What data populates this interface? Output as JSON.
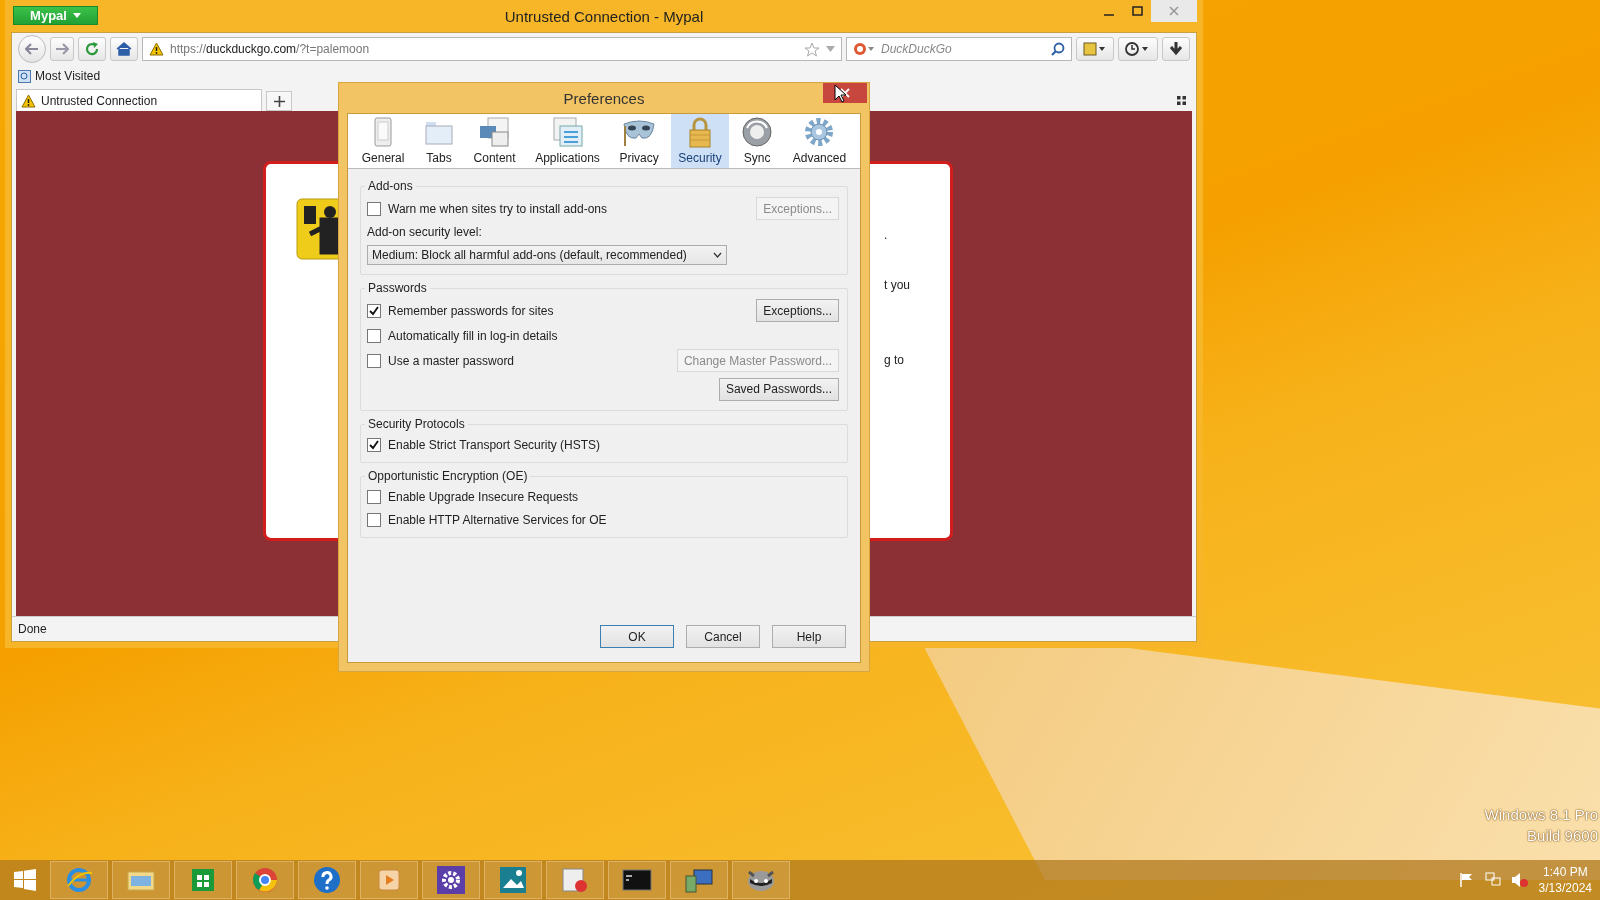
{
  "browser": {
    "app_menu": "Mypal",
    "title": "Untrusted Connection - Mypal",
    "url": {
      "scheme": "https://",
      "domain": "duckduckgo.com",
      "path": "/?t=palemoon"
    },
    "search_placeholder": "DuckDuckGo",
    "bookmarks": [
      "Most Visited"
    ],
    "tabs": [
      {
        "label": "Untrusted Connection",
        "selected": true
      }
    ],
    "page_fragments": [
      ".",
      "t you",
      "g to"
    ],
    "status": "Done"
  },
  "dialog": {
    "title": "Preferences",
    "panes": [
      {
        "label": "General",
        "selected": false
      },
      {
        "label": "Tabs",
        "selected": false
      },
      {
        "label": "Content",
        "selected": false
      },
      {
        "label": "Applications",
        "selected": false
      },
      {
        "label": "Privacy",
        "selected": false
      },
      {
        "label": "Security",
        "selected": true
      },
      {
        "label": "Sync",
        "selected": false
      },
      {
        "label": "Advanced",
        "selected": false
      }
    ],
    "sections": [
      {
        "title": "Add-ons",
        "rows": [
          {
            "kind": "checkbox",
            "label": "Warn me when sites try to install add-ons",
            "checked": false,
            "button": {
              "label": "Exceptions...",
              "disabled": true
            }
          },
          {
            "kind": "label",
            "label": "Add-on security level:"
          },
          {
            "kind": "select",
            "value": "Medium: Block all harmful add-ons (default, recommended)"
          }
        ]
      },
      {
        "title": "Passwords",
        "rows": [
          {
            "kind": "checkbox",
            "label": "Remember passwords for sites",
            "checked": true,
            "button": {
              "label": "Exceptions...",
              "disabled": false
            }
          },
          {
            "kind": "checkbox",
            "label": "Automatically fill in log-in details",
            "checked": false
          },
          {
            "kind": "checkbox",
            "label": "Use a master password",
            "checked": false,
            "button": {
              "label": "Change Master Password...",
              "disabled": true
            }
          },
          {
            "kind": "button",
            "button": {
              "label": "Saved Passwords...",
              "disabled": false
            }
          }
        ]
      },
      {
        "title": "Security Protocols",
        "rows": [
          {
            "kind": "checkbox",
            "label": "Enable Strict Transport Security (HSTS)",
            "checked": true
          }
        ]
      },
      {
        "title": "Opportunistic Encryption (OE)",
        "rows": [
          {
            "kind": "checkbox",
            "label": "Enable Upgrade Insecure Requests",
            "checked": false
          },
          {
            "kind": "checkbox",
            "label": "Enable HTTP Alternative Services for OE",
            "checked": false
          }
        ]
      }
    ],
    "buttons": [
      {
        "label": "OK",
        "default": true
      },
      {
        "label": "Cancel",
        "default": false
      },
      {
        "label": "Help",
        "default": false
      }
    ]
  },
  "desktop": {
    "watermark": [
      "Windows 8.1 Pro",
      "Build 9600"
    ]
  },
  "taskbar": {
    "time": "1:40 PM",
    "date": "3/13/2024"
  }
}
